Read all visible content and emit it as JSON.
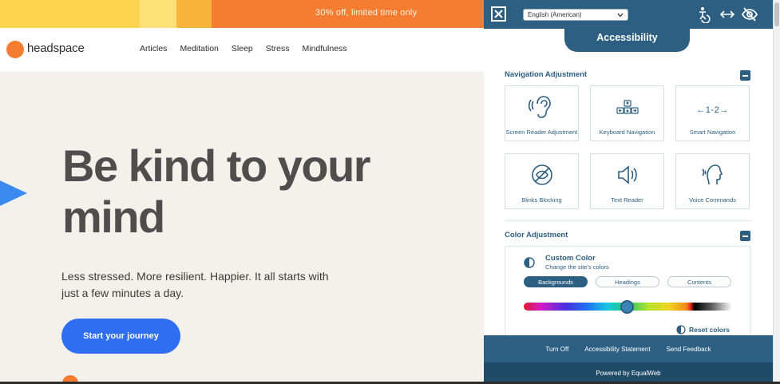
{
  "site": {
    "promo_text": "30% off, limited time only",
    "logo_text": "headspace",
    "nav": [
      "Articles",
      "Meditation",
      "Sleep",
      "Stress",
      "Mindfulness"
    ],
    "hero_title": "Be kind to your mind",
    "hero_sub": "Less stressed. More resilient. Happier. It all starts with just a few minutes a day.",
    "cta_label": "Start your journey",
    "colors": {
      "brand_orange": "#f47d31",
      "cta_blue": "#2f6ef0",
      "hero_bg": "#f4f1ed"
    }
  },
  "panel": {
    "language": "English (American)",
    "tab_title": "Accessibility",
    "icons": [
      "close-icon",
      "accessibility-person-icon",
      "arrows-horizontal-icon",
      "eye-off-icon"
    ],
    "navigation": {
      "title": "Navigation Adjustment",
      "tiles": [
        {
          "label": "Screen Reader Adjustment",
          "icon": "ear-icon"
        },
        {
          "label": "Keyboard Navigation",
          "icon": "keyboard-icon"
        },
        {
          "label": "Smart Navigation",
          "icon": "smart-navigation-icon",
          "glyph": "←1-2→"
        },
        {
          "label": "Blinks Blocking",
          "icon": "blink-block-icon"
        },
        {
          "label": "Text Reader",
          "icon": "speaker-icon"
        },
        {
          "label": "Voice Commands",
          "icon": "voice-icon"
        }
      ]
    },
    "color": {
      "title": "Color Adjustment",
      "custom_title": "Custom Color",
      "custom_sub": "Change the site's colors",
      "segments": [
        "Backgrounds",
        "Headings",
        "Contents"
      ],
      "active_segment": "Backgrounds",
      "reset_label": "Reset colors"
    },
    "footer": {
      "links": [
        "Turn Off",
        "Accessibility Statement",
        "Send Feedback"
      ],
      "powered_by": "Powered by EqualWeb"
    },
    "colors": {
      "header_blue": "#2c5f82",
      "footer_dark": "#1f4a68"
    }
  }
}
